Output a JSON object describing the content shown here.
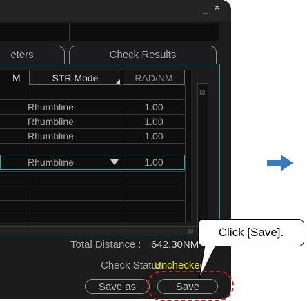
{
  "window": {
    "min_icon": "minimize-icon",
    "close_icon": "close-icon"
  },
  "tabs": {
    "params": "eters",
    "check": "Check Results"
  },
  "table": {
    "headers": {
      "nm": "M",
      "str": "STR Mode",
      "rad": "RAD/NM"
    },
    "rows": [
      {
        "str": "Rhumbline",
        "rad": "1.00"
      },
      {
        "str": "Rhumbline",
        "rad": "1.00"
      },
      {
        "str": "Rhumbline",
        "rad": "1.00"
      },
      {
        "str": "Rhumbline",
        "rad": "1.00"
      }
    ]
  },
  "summary": {
    "total_label": "Total Distance :",
    "total_value": "642.30NM",
    "check_label": "Check Status:",
    "check_value": "Unchecked"
  },
  "buttons": {
    "save_as": "Save as",
    "save": "Save"
  },
  "annotation": {
    "callout": "Click [Save].",
    "highlight_color": "#cc1a1a",
    "arrow_color": "#3b78c2"
  }
}
